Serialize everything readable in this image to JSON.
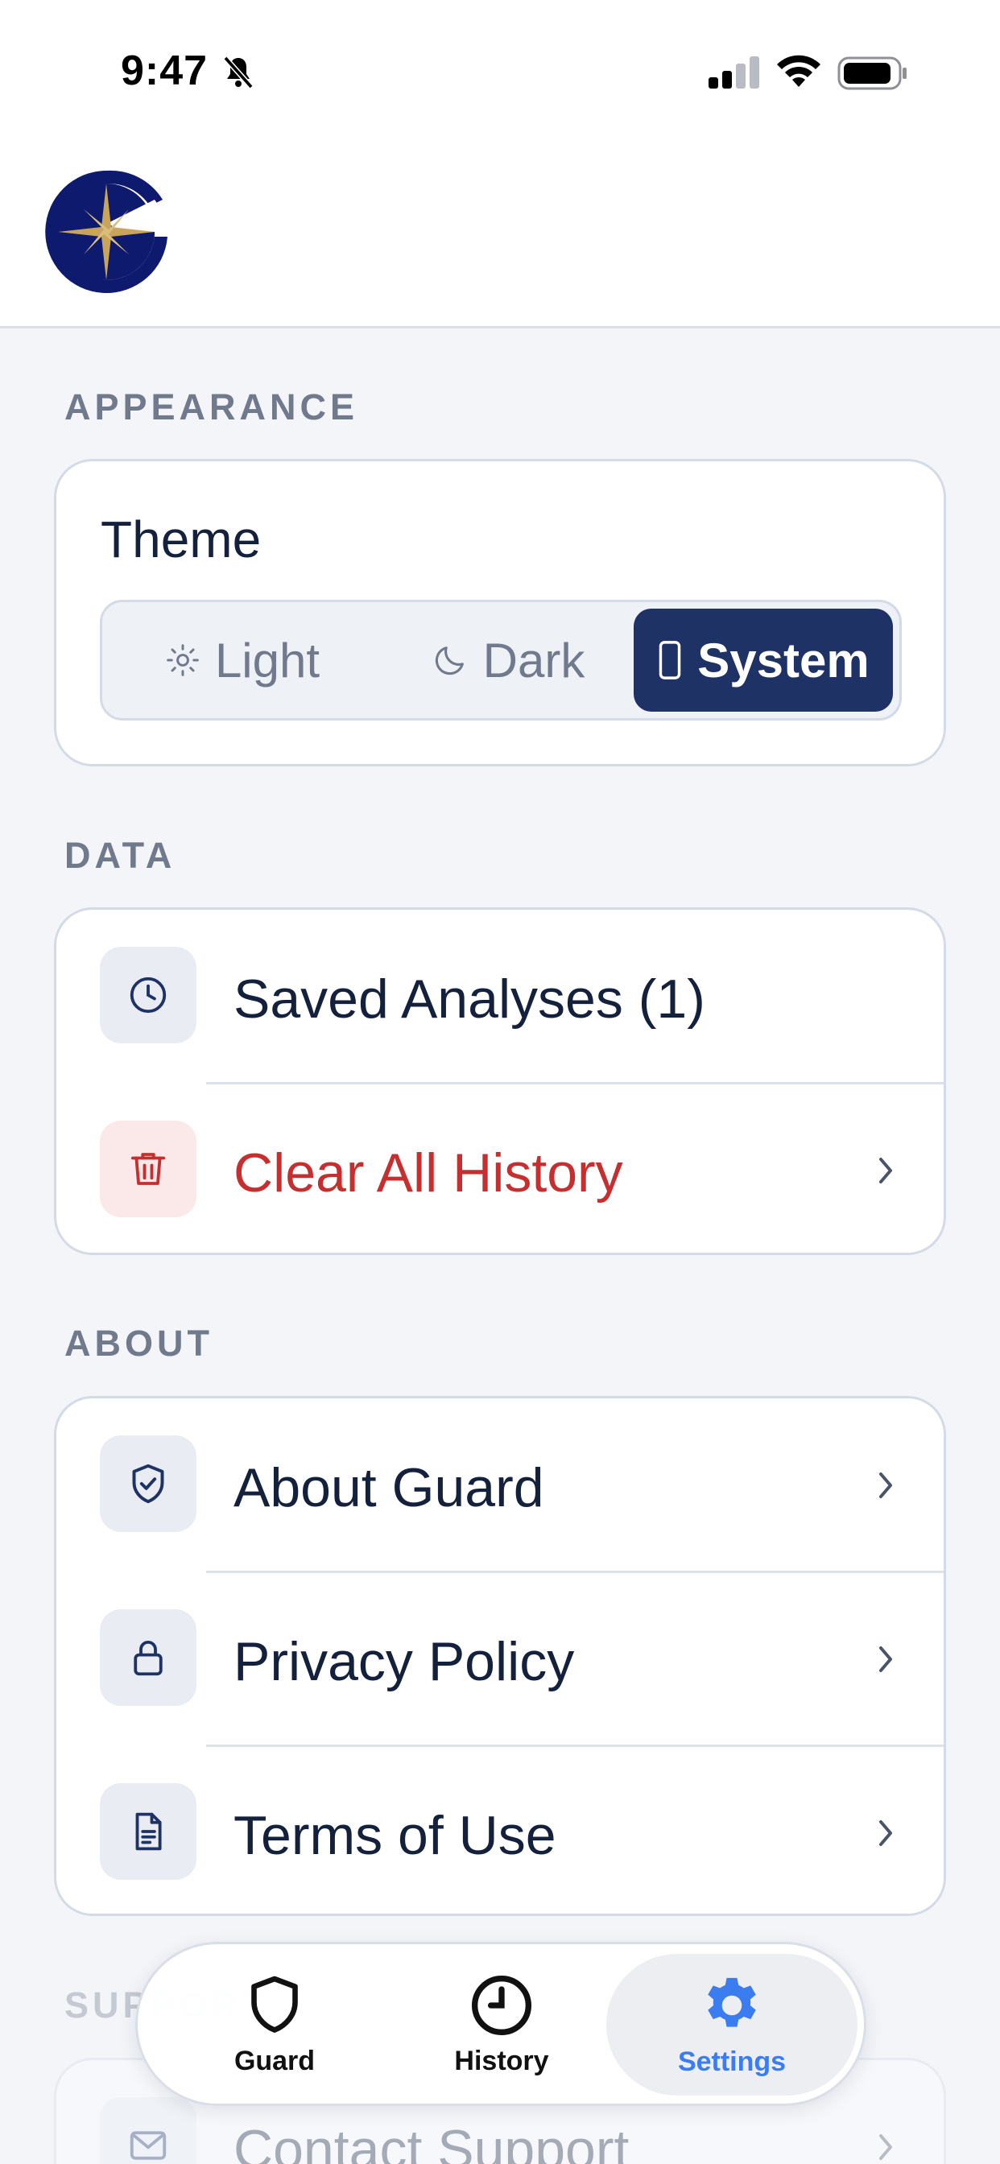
{
  "status_bar": {
    "time": "9:47"
  },
  "sections": {
    "appearance": {
      "title": "APPEARANCE",
      "theme_label": "Theme",
      "options": [
        {
          "label": "Light",
          "icon": "sun-icon"
        },
        {
          "label": "Dark",
          "icon": "moon-icon"
        },
        {
          "label": "System",
          "icon": "phone-icon"
        }
      ],
      "selected": "System"
    },
    "data": {
      "title": "DATA",
      "items": [
        {
          "label": "Saved Analyses (1)",
          "icon": "clock-icon"
        },
        {
          "label": "Clear All History",
          "icon": "trash-icon"
        }
      ]
    },
    "about": {
      "title": "ABOUT",
      "items": [
        {
          "label": "About Guard",
          "icon": "shield-check-icon"
        },
        {
          "label": "Privacy Policy",
          "icon": "lock-icon"
        },
        {
          "label": "Terms of Use",
          "icon": "document-icon"
        }
      ]
    },
    "support": {
      "title": "SUPPORT",
      "items": [
        {
          "label": "Contact Support",
          "icon": "mail-icon"
        }
      ]
    }
  },
  "tab_bar": {
    "tabs": [
      {
        "label": "Guard",
        "icon": "shield-icon"
      },
      {
        "label": "History",
        "icon": "clock-icon"
      },
      {
        "label": "Settings",
        "icon": "gear-icon"
      }
    ],
    "active": "Settings"
  },
  "colors": {
    "accent_navy": "#1e3266",
    "danger_red": "#c62f2f",
    "active_tab_blue": "#3b7df0",
    "logo_gold": "#c9a55c"
  }
}
